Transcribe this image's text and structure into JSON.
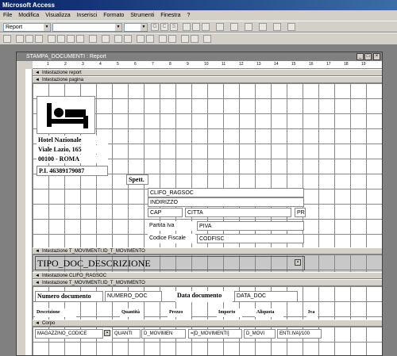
{
  "app_title": "Microsoft Access",
  "menu": [
    "File",
    "Modifica",
    "Visualizza",
    "Inserisci",
    "Formato",
    "Strumenti",
    "Finestra",
    "?"
  ],
  "toolbar": {
    "object_combo": "Report",
    "font_combo": "",
    "size_combo": "",
    "bold": "G",
    "italic": "C",
    "underline": "S"
  },
  "report_title": "STAMPA_DOCUMENTI : Report",
  "ruler_marks": [
    "1",
    "2",
    "3",
    "4",
    "5",
    "6",
    "7",
    "8",
    "9",
    "10",
    "11",
    "12",
    "13",
    "14",
    "15",
    "16",
    "17",
    "18",
    "19"
  ],
  "sections": {
    "report_header": "Intestazione report",
    "page_header": "Intestazione pagina",
    "group_mov1": "Intestazione T_MOVIMENTI.ID_T_MOVIMENTO",
    "group_clifo": "Intestazione CLIFO_RAGSOC",
    "group_mov2": "Intestazione T_MOVIMENTI.ID_T_MOVIMENTO",
    "detail": "Corpo"
  },
  "page_header": {
    "hotel_name": "Hotel Nazionale",
    "address": "Viale Lazio, 165",
    "city": "00100 - ROMA",
    "vat": "P.I. 46389179087",
    "spett": "Spett.",
    "clifo_ragsoc": "CLIFO_RAGSOC",
    "indirizzo": "INDIRIZZO",
    "cap": "CAP",
    "citta": "CITTA",
    "prov": "PR(",
    "partita_iva_lbl": "Partita Iva",
    "piva": "PIVA",
    "codice_fiscale_lbl": "Codice Fiscale",
    "codfisc": "CODFISC"
  },
  "group1": {
    "tipo_doc": "TIPO_DOC_DESCRIZIONE"
  },
  "group2": {
    "numero_lbl": "Numero documento",
    "numero_doc": "NUMERO_DOC",
    "data_lbl": "Data documento",
    "data_doc": "DATA_DOC",
    "col_descrizione": "Descrizione",
    "col_quantita": "Quantità",
    "col_prezzo": "Prezzo",
    "col_importo": "Importo",
    "col_aliquota": "Aliquota",
    "col_iva": "Iva"
  },
  "detail": {
    "magazzino": "MAGAZZINO_CODICE",
    "quanti": "QUANTI",
    "d_mov1": "D_MOVIMEN",
    "d_mov2": "=[D_MOVIMENTI]",
    "d_mov3": "D_MOVI",
    "iva_calc": "ENTI.IVA]/100"
  }
}
